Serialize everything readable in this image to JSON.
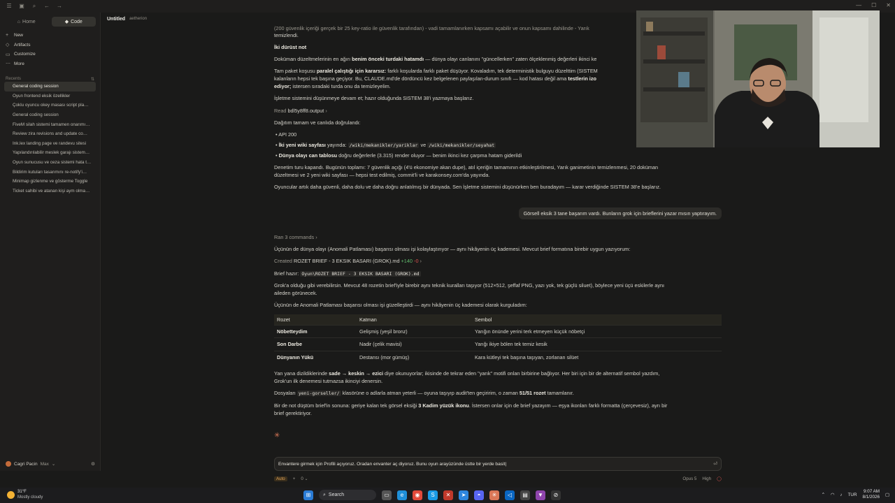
{
  "sidebar": {
    "tabs": [
      {
        "label": "Home",
        "icon": "home-icon"
      },
      {
        "label": "Code",
        "icon": "code-icon"
      }
    ],
    "nav": [
      {
        "label": "New",
        "icon": "plus-icon"
      },
      {
        "label": "Artifacts",
        "icon": "artifacts-icon"
      },
      {
        "label": "Customize",
        "icon": "customize-icon"
      },
      {
        "label": "More",
        "icon": "more-icon"
      }
    ],
    "recents_label": "Recents",
    "recents": [
      "General coding session",
      "Oyun frontend eksik özellikler",
      "Çoklu oyuncu okey masası script pla…",
      "General coding session",
      "FiveM silah sistemi tamamen onarımı…",
      "Review zira revisions and update co…",
      "Ink.lex landing page ve randevu sitesi",
      "Yapılandırılabilir meslek garajı sistem…",
      "Oyun sunucusu ve ceza sistemi hata t…",
      "Bildirim kutuları tasarımını re-notify'i…",
      "Minimap gizlenme ve gösterme Toggle",
      "Ticket sahibi ve atanan kişi aym olma…"
    ],
    "user_name": "Cagri Pacin",
    "user_plan": "Max"
  },
  "tab": {
    "title": "Untitled",
    "subtitle": "aetherion"
  },
  "content": {
    "line0": "(200 güvenlik içeriği gerçek bir 25 key-ratio ile güvenlik tarafından) - vadi tamamlanırken kapsamı açabilir ve onun kapsamı dahilinde - Yarık",
    "line1": "temizlendi.",
    "honest_note": "İki dürüst not",
    "p1_pre": "Doküman düzeltmelerinin en ağırı ",
    "p1_bold": "benim önceki turdaki hatamdı",
    "p1_post": " — dünya olayı canlanını \"güncellerken\" zaten ölçeklenmiş değerleri ikinci ke",
    "p2_pre": "Tam paket koşusu ",
    "p2_bold": "paralel çalıştığı için kararsız:",
    "p2_post1": " farklı koşularda farklı paket düşüyor. Kovaladım, tek deterministik bulguyu düzelttim (SISTEM",
    "p2_post2": "kalanların hepsi tek başına geçiyor. Bu, CLAUDE.md'de dördüncü kez belgelenen paylaşılan-durum sınıfı — kod hatası değil ama ",
    "p2_bold2": "testlerin izo",
    "p2_bold3": "ediyor;",
    "p2_post3": " istersen sıradaki turda onu da temizleyelim.",
    "p3": "İşletme sistemini düşünmeye devam et; hazır olduğunda SISTEM 38'i yazmaya başlarız.",
    "read_label": "Read",
    "read_file": "bdl5y8ff8.output",
    "deploy": "Dağıtım tamam ve canlıda doğrulandı:",
    "bullet1": "API 200",
    "bullet2_bold": "İki yeni wiki sayfası",
    "bullet2_mid": " yayında: ",
    "bullet2_code1": "/wiki/mekanikler/yariklar",
    "bullet2_and": " ve ",
    "bullet2_code2": "/wiki/mekanikler/seyahat",
    "bullet3_bold": "Dünya olayı can tablosu",
    "bullet3_post": " doğru değerlerle (3.315) render oluyor — benim ikinci kez çarpma hatam giderildi",
    "summary1": "Denetim turu kapandı. Bugünün toplamı: 7 güvenlik açığı (4'ü ekonomiye akan dupe), atıl içeriğin tamamının etkinleştirilmesi, Yarık ganimetinin temizlenmesi, 20 doküman",
    "summary2": "düzeltmesi ve 2 yeni wiki sayfası — hepsi test edilmiş, commit'li ve karakonsey.com'da yayında.",
    "summary3": "Oyuncular artık daha güvenli, daha dolu ve daha doğru anlatılmış bir dünyada. Sen İşletme sistemini düşünürken ben buradayım — karar verdiğinde SISTEM 38'e başlarız.",
    "user_message": "Görsell eksik 3 tane başarım vardı. Bunların grok için brieflerini yazar mısın yaptırayım.",
    "ran_commands": "Ran 3 commands",
    "intro": "Üçünün de dünya olayı (Anomali Patlaması) başarısı olması işi kolaylaştırıyor — aynı hikâyenin üç kademesi. Mevcut brief formatına birebir uygun yazıyorum:",
    "created_label": "Created",
    "created_file": "ROZET BRIEF - 3 EKSIK BASARI (GROK).md",
    "created_plus": "+140",
    "created_minus": "-0",
    "brief_label": "Brief hazır:",
    "brief_path": "Oyun\\ROZET BRIEF - 3 EKSIK BASARI (GROK).md",
    "grok1": "Grok'a olduğu gibi verebilirsin. Mevcut 48 rozetin brief'iyle birebir aynı teknik kuralları taşıyor (512×512, şeffaf PNG, yazı yok, tek güçlü siluet), böylece yeni üçü eskilerle aynı",
    "grok2": "aileden görünecek.",
    "table_intro": "Üçünün de Anomali Patlaması başarısı olması işi güzelleştirdi — aynı hikâyenin üç kademesi olarak kurguladım:",
    "table_headers": [
      "Rozet",
      "Katman",
      "Sembol"
    ],
    "table_rows": [
      [
        "Nöbetteydim",
        "Gelişmiş (yeşil bronz)",
        "Yarığın önünde yerini terk etmeyen küçük nöbetçi"
      ],
      [
        "Son Darbe",
        "Nadir (çelik mavisi)",
        "Yarığı ikiye bölen tek temiz kesik"
      ],
      [
        "Dünyanın Yükü",
        "Destansı (mor gümüş)",
        "Kara kütleyi tek başına taşıyan, zorlanan silüet"
      ]
    ],
    "order1_pre": "Yan yana dizildiklerinde ",
    "order1_bold": "sade → keskin → ezici",
    "order1_post": " diye okunuyorlar; ikisinde de tekrar eden \"yarık\" motifi onları birbirine bağlıyor. Her biri için bir de alternatif sembol yazdım,",
    "order2": "Grok'un ilk denemesi tutmazsa ikinciyi denersin.",
    "files_pre": "Dosyaları ",
    "files_code": "yeni-gorseller/",
    "files_mid": " klasörüne o adlarla atman yeterli — oyuna taşıyıp audit'ten geçiririm, o zaman ",
    "files_bold": "51/51 rozet",
    "files_post": " tamamlanır.",
    "note1_pre": "Bir de not düştüm brief'in sonuna: geriye kalan tek görsel eksiği ",
    "note1_bold": "3 Kadim yüzük ikonu",
    "note1_post": ". İstersen onlar için de brief yazayım — eşya ikonları farklı formatta (çerçevesiz), ayrı bir",
    "note2": "brief gerektiriyor."
  },
  "input": {
    "value": "Envantere girmek için Profili açıyoruz. Oradan envanter aç diyoruz. Bunu oyun arayüzünde üstte bir yerde basit",
    "mode": "Auto",
    "count": "0",
    "model": "Opus 5",
    "effort": "High"
  },
  "taskbar": {
    "temp": "31°F",
    "weather": "Mostly cloudy",
    "search": "Search",
    "lang": "TUR",
    "time": "9:07 AM",
    "date": "8/1/2026"
  },
  "colors": {
    "accent": "#d97757",
    "added": "#5fb86b",
    "removed": "#d9534f"
  }
}
